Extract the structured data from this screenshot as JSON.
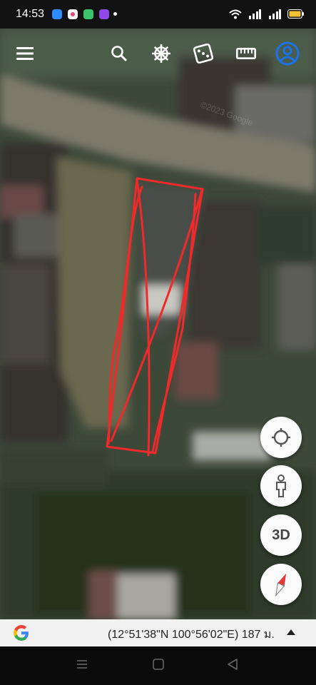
{
  "status_bar": {
    "time": "14:53",
    "notifications": [
      "message-app-icon",
      "photo-app-icon",
      "chat-app-icon",
      "game-app-icon"
    ],
    "indicators": [
      "wifi-icon",
      "signal-icon",
      "signal-icon",
      "battery-icon"
    ]
  },
  "toolbar": {
    "buttons": [
      "menu-icon",
      "search-icon",
      "voyager-wheel-icon",
      "feeling-lucky-dice-icon",
      "measure-ruler-icon",
      "account-icon"
    ]
  },
  "map": {
    "watermark": "©2023 Google",
    "annotation_color": "#f02a2a"
  },
  "controls": {
    "locate": "crosshair-icon",
    "street_view": "pegman-icon",
    "view_3d_label": "3D",
    "compass": "compass-icon"
  },
  "info_bar": {
    "coordinates": "(12°51'38\"N 100°56'02\"E) 187 ม."
  },
  "colors": {
    "accent_blue": "#1a73e8",
    "annotation_red": "#f02a2a"
  }
}
